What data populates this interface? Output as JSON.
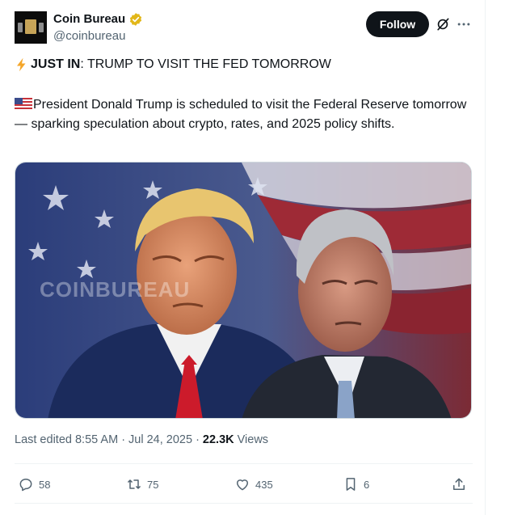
{
  "author": {
    "display_name": "Coin Bureau",
    "handle": "@coinbureau",
    "follow_label": "Follow"
  },
  "post": {
    "headline_bold": "JUST IN",
    "headline_rest": ": TRUMP TO VISIT THE FED TOMORROW",
    "body": "President Donald Trump is scheduled to visit the Federal Reserve tomorrow — sparking speculation about crypto, rates, and 2025 policy shifts.",
    "media_watermark": "COINBUREAU"
  },
  "meta": {
    "edited": "Last edited 8:55 AM · Jul 24, 2025 · ",
    "views_count": "22.3K",
    "views_label": "Views"
  },
  "actions": {
    "replies": "58",
    "reposts": "75",
    "likes": "435",
    "bookmarks": "6"
  },
  "colors": {
    "accent": "#0f1419",
    "muted": "#536471",
    "verified": "#e2b719"
  }
}
